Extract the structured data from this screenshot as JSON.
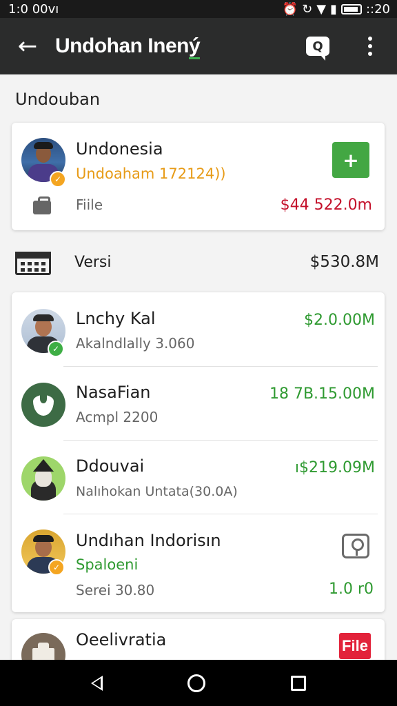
{
  "status_bar": {
    "time_left": "1:0 00vı",
    "time_right": "::20"
  },
  "app_bar": {
    "title_main": "Undohan Inen",
    "title_accent": "ý",
    "chat_icon_glyph": "Q"
  },
  "section": {
    "title": "Undouban"
  },
  "featured": {
    "name": "Undonesia",
    "subtitle": "Undoaham 172124))",
    "file_label": "Fiile",
    "amount": "$44 522.0m"
  },
  "summary": {
    "label": "Versi",
    "amount": "$530.8M"
  },
  "list": [
    {
      "name": "Lnchy Kal",
      "sub": "Akalndlally 3.060",
      "amount": "$2.0.00M"
    },
    {
      "name": "NasaFian",
      "sub": "Acmpl 2200",
      "amount": "18 7B.15.00M"
    },
    {
      "name": "Ddouvai",
      "sub": "Nalıhokan Untata(30.0A)",
      "amount": "ı$219.09M"
    },
    {
      "name": "Undıhan Indorisın",
      "sub_green": "Spaloeni",
      "sub": "Serei 30.80",
      "amount": "1.0 r0"
    }
  ],
  "partial": {
    "name": "Oeelivratia",
    "file_badge": "File"
  },
  "colors": {
    "appbar": "#2b2c2c",
    "green": "#43a743",
    "red": "#c4112b",
    "orange": "#e79b17"
  }
}
